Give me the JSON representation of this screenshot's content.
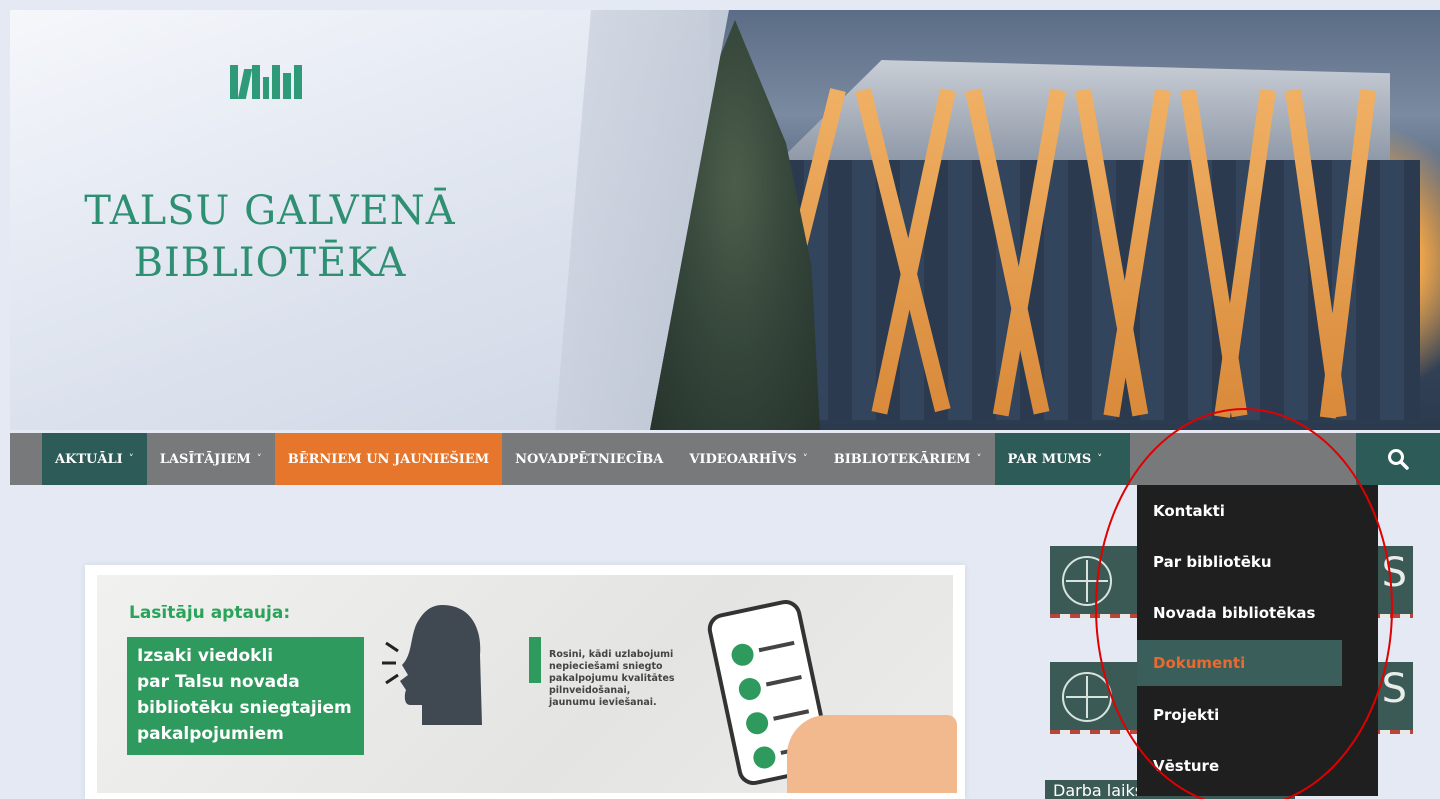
{
  "brand": {
    "title_line1": "TALSU GALVENĀ",
    "title_line2": "BIBLIOTĒKA",
    "logo_icon": "bookshelf-logo-icon"
  },
  "nav": {
    "items": [
      {
        "label": "AKTUĀLI",
        "has_dropdown": true
      },
      {
        "label": "LASĪTĀJIEM",
        "has_dropdown": true
      },
      {
        "label": "BĒRNIEM UN JAUNIEŠIEM",
        "has_dropdown": false
      },
      {
        "label": "NOVADPĒTNIECĪBA",
        "has_dropdown": false
      },
      {
        "label": "VIDEOARHĪVS",
        "has_dropdown": true
      },
      {
        "label": "BIBLIOTEKĀRIEM",
        "has_dropdown": true
      },
      {
        "label": "PAR MUMS",
        "has_dropdown": true
      }
    ],
    "chevron": "˅",
    "search_icon": "search-icon"
  },
  "dropdown": {
    "items": [
      "Kontakti",
      "Par bibliotēku",
      "Novada bibliotēkas",
      "Dokumenti",
      "Projekti",
      "Vēsture"
    ],
    "active": "Dokumenti"
  },
  "banner": {
    "title": "Lasītāju aptauja:",
    "box_lines": [
      "Izsaki viedokli",
      "par Talsu novada",
      "bibliotēku sniegtajiem",
      "pakalpojumiem"
    ],
    "text_lines": [
      "Rosini, kādi uzlabojumi",
      "nepieciešami sniegto",
      "pakalpojumu kvalitātes",
      "pilnveidošanai,",
      "jaunumu ieviešanai."
    ]
  },
  "sidebar": {
    "widget_letter": "S",
    "footer_text": "Darba laiks un kontakti"
  },
  "colors": {
    "teal": "#2d5b57",
    "orange": "#e5762b",
    "nav_gray": "#78797b",
    "brand_green": "#2e8f72",
    "dropdown_bg": "#1f1f1f"
  }
}
